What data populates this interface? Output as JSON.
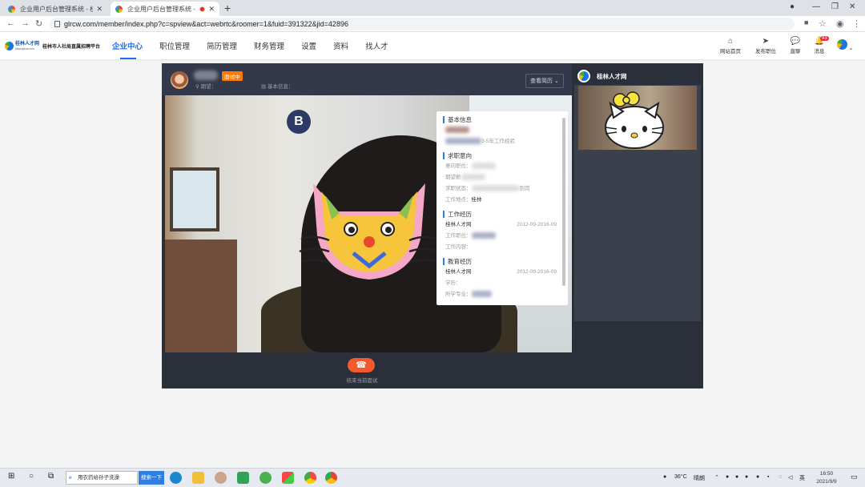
{
  "browser": {
    "tabs": [
      {
        "title": "企业用户后台管理系统 - 桂林人才网"
      },
      {
        "title": "企业用户后台管理系统 - 桂林人才网"
      }
    ],
    "url": "glrcw.com/member/index.php?c=spview&act=webrtc&roomer=1&fuid=391322&jid=42896"
  },
  "site": {
    "logo_brand": "桂林人才网",
    "logo_sub": "www.glrcw.com",
    "logo_platform": "桂林市人社局直属招聘平台",
    "menu": [
      {
        "label": "企业中心",
        "active": true
      },
      {
        "label": "职位管理",
        "active": false
      },
      {
        "label": "简历管理",
        "active": false
      },
      {
        "label": "财务管理",
        "active": false
      },
      {
        "label": "设置",
        "active": false
      },
      {
        "label": "资料",
        "active": false
      },
      {
        "label": "找人才",
        "active": false
      }
    ],
    "actions": [
      {
        "label": "网站首页",
        "icon": "home-icon"
      },
      {
        "label": "发布职位",
        "icon": "send-icon"
      },
      {
        "label": "直聊",
        "icon": "chat-icon"
      },
      {
        "label": "消息",
        "icon": "bell-icon",
        "badge": "93"
      }
    ],
    "accent": "#1b6ef3"
  },
  "interview": {
    "status": "面试中",
    "expect_label": "期望：",
    "basic_label": "基本信息：",
    "view_resume": "查看简历",
    "end_label": "结束当前面试",
    "end_color": "#f2592c"
  },
  "resume": {
    "sec_basic": "基本信息",
    "exp_text": "3-5年工作经验",
    "sec_intent": "求职意向",
    "intent_pos": "意向职位：",
    "intent_salary": "期望薪",
    "intent_status": "求职状态：",
    "intent_status_tail": "到岗",
    "intent_loc": "工作地点：",
    "intent_loc_val": "桂林",
    "sec_work": "工作经历",
    "work_company": "桂林人才网",
    "work_dates": "2012-09-2016-09",
    "work_pos": "工作职位：",
    "work_content": "工作内容：",
    "sec_edu": "教育经历",
    "edu_school": "桂林人才网",
    "edu_dates": "2012-09-2016-09",
    "edu_degree": "学历：",
    "edu_major": "所学专业："
  },
  "side": {
    "name": "桂林人才网"
  },
  "taskbar": {
    "search_text": "用农药给孙子洗澡",
    "search_btn": "搜索一下",
    "weather": "36°C",
    "weather_desc": "晴朗",
    "ime": "英",
    "time": "16:50",
    "date": "2021/9/9"
  }
}
